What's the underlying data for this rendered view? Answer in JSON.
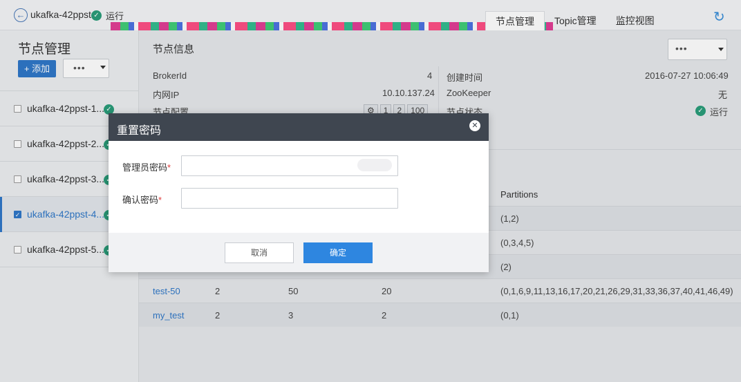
{
  "header": {
    "instance_name": "ukafka-42ppst",
    "status": "运行",
    "tabs": [
      {
        "label": "节点管理",
        "active": true
      },
      {
        "label": "Topic管理",
        "active": false
      },
      {
        "label": "监控视图",
        "active": false
      }
    ],
    "icons": {
      "back": "back-arrow-icon",
      "refresh": "refresh-icon",
      "status": "check-circle-icon"
    }
  },
  "sidebar": {
    "title": "节点管理",
    "add_label": "+ 添加",
    "more_label": "•••",
    "items": [
      {
        "label": "ukafka-42ppst-1...",
        "checked": false,
        "selected": false
      },
      {
        "label": "ukafka-42ppst-2...",
        "checked": false,
        "selected": false
      },
      {
        "label": "ukafka-42ppst-3...",
        "checked": false,
        "selected": false
      },
      {
        "label": "ukafka-42ppst-4...",
        "checked": true,
        "selected": true
      },
      {
        "label": "ukafka-42ppst-5...",
        "checked": false,
        "selected": false
      }
    ]
  },
  "main": {
    "info_title": "节点信息",
    "more_label": "•••",
    "info": {
      "broker_id_label": "BrokerId",
      "broker_id": "4",
      "ip_label": "内网IP",
      "ip": "10.10.137.24",
      "config_label": "节点配置",
      "config_values": [
        "1",
        "2",
        "100"
      ],
      "created_label": "创建时间",
      "created": "2016-07-27 10:06:49",
      "zk_label": "ZooKeeper",
      "zk": "无",
      "status_label": "节点状态",
      "status": "运行"
    },
    "table": {
      "partitions_header": "Partitions",
      "rows": [
        {
          "name": "",
          "c1": "",
          "c2": "",
          "c3": "",
          "partitions": "(1,2)"
        },
        {
          "name": "",
          "c1": "",
          "c2": "",
          "c3": "",
          "partitions": "(0,3,4,5)"
        },
        {
          "name": "",
          "c1": "",
          "c2": "",
          "c3": "",
          "partitions": "(2)"
        },
        {
          "name": "test-50",
          "c1": "2",
          "c2": "50",
          "c3": "20",
          "partitions": "(0,1,6,9,11,13,16,17,20,21,26,29,31,33,36,37,40,41,46,49)"
        },
        {
          "name": "my_test",
          "c1": "2",
          "c2": "3",
          "c3": "2",
          "partitions": "(0,1)"
        }
      ]
    }
  },
  "modal": {
    "title": "重置密码",
    "admin_password_label": "管理员密码",
    "confirm_password_label": "确认密码",
    "required_mark": "*",
    "admin_password_value": "",
    "confirm_password_value": "",
    "cancel_label": "取消",
    "ok_label": "确定"
  },
  "colors": {
    "accent": "#2f78c8",
    "primary_button": "#2e86e0",
    "modal_header": "#3f4650",
    "status_ok": "#2a9d7a",
    "required": "#e03c3c"
  }
}
